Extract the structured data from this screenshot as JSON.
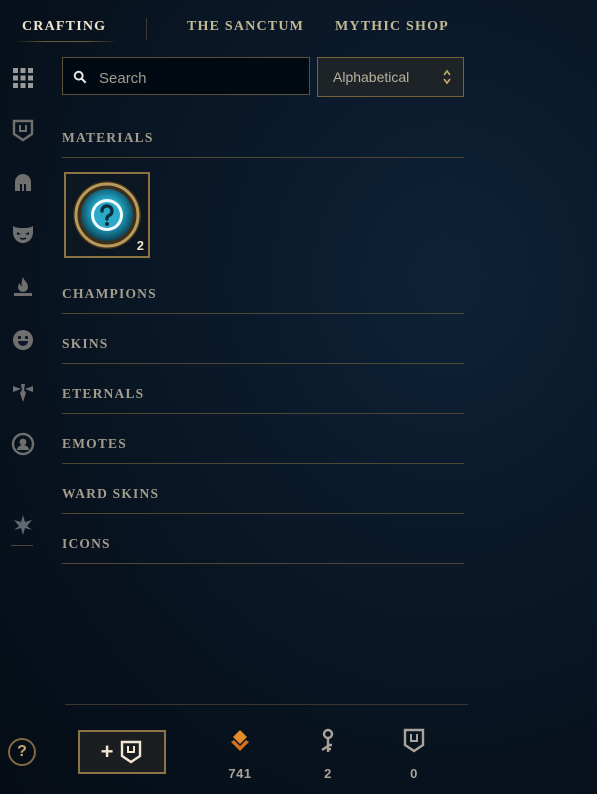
{
  "nav": {
    "tabs": [
      {
        "label": "CRAFTING",
        "active": true
      },
      {
        "label": "THE SANCTUM",
        "active": false
      },
      {
        "label": "MYTHIC SHOP",
        "active": false
      }
    ]
  },
  "sidebar": {
    "icons": [
      "grid-icon",
      "chest-icon",
      "helmet-icon",
      "mask-icon",
      "flame-icon",
      "emote-face-icon",
      "ward-icon",
      "profile-icon",
      "crest-icon"
    ]
  },
  "search": {
    "placeholder": "Search",
    "value": ""
  },
  "sort": {
    "selected": "Alphabetical"
  },
  "sections": {
    "materials": "MATERIALS",
    "champions": "CHAMPIONS",
    "skins": "SKINS",
    "eternals": "ETERNALS",
    "emotes": "EMOTES",
    "ward_skins": "WARD SKINS",
    "icons": "ICONS"
  },
  "materials_item": {
    "icon": "mystery-orb-icon",
    "count": "2"
  },
  "footer": {
    "help_label": "?",
    "add_label": "+",
    "currencies": [
      {
        "icon": "orange-essence-icon",
        "value": "741",
        "color": "#e58b2a"
      },
      {
        "icon": "key-icon",
        "value": "2",
        "color": "#a9a39a"
      },
      {
        "icon": "chest-icon",
        "value": "0",
        "color": "#a9a39a"
      }
    ]
  },
  "colors": {
    "gold": "#c8aa6e",
    "text_muted": "#a39d8d",
    "background": "#07111c"
  }
}
